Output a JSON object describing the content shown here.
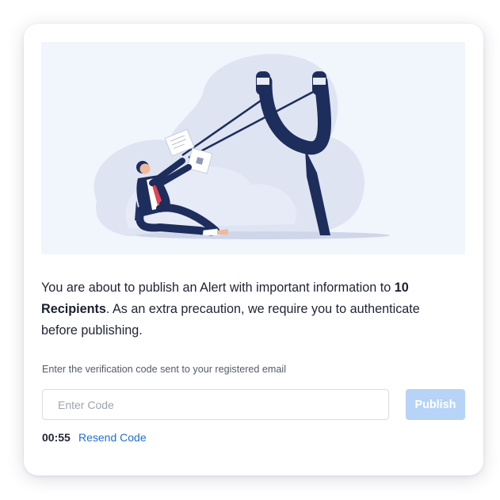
{
  "message": {
    "prefix": "You are about to publish an Alert with important information to ",
    "recipients": "10 Recipients",
    "suffix": ". As an extra precaution, we require you to authenticate before publishing."
  },
  "verification": {
    "hint": "Enter the verification code sent to your registered email",
    "placeholder": "Enter Code",
    "value": ""
  },
  "actions": {
    "publish_label": "Publish",
    "publish_enabled": false,
    "resend_label": "Resend Code"
  },
  "timer": {
    "countdown": "00:55"
  },
  "illustration": {
    "subject": "slingshot-businessman-illustration"
  },
  "colors": {
    "accent": "#1f6fd0",
    "button_disabled": "#b7d3f7",
    "navy": "#1d2d5c",
    "tie": "#e0455a"
  }
}
